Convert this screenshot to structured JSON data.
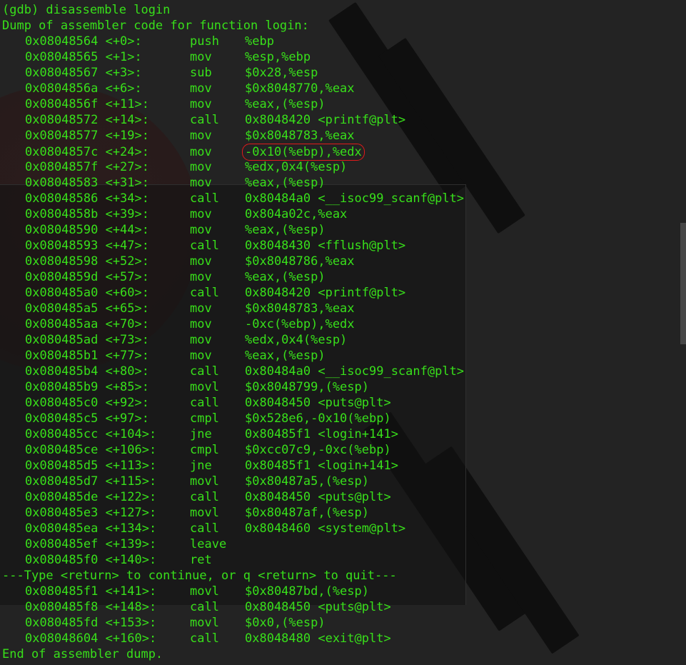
{
  "command_line": "(gdb) disassemble login",
  "dump_header": "Dump of assembler code for function login:",
  "instructions": [
    {
      "addr": "0x08048564 <+0>:",
      "op": "push",
      "args": "%ebp"
    },
    {
      "addr": "0x08048565 <+1>:",
      "op": "mov",
      "args": "%esp,%ebp"
    },
    {
      "addr": "0x08048567 <+3>:",
      "op": "sub",
      "args": "$0x28,%esp"
    },
    {
      "addr": "0x0804856a <+6>:",
      "op": "mov",
      "args": "$0x8048770,%eax"
    },
    {
      "addr": "0x0804856f <+11>:",
      "op": "mov",
      "args": "%eax,(%esp)"
    },
    {
      "addr": "0x08048572 <+14>:",
      "op": "call",
      "args": "0x8048420 <printf@plt>"
    },
    {
      "addr": "0x08048577 <+19>:",
      "op": "mov",
      "args": "$0x8048783,%eax"
    },
    {
      "addr": "0x0804857c <+24>:",
      "op": "mov",
      "args": "-0x10(%ebp),%edx"
    },
    {
      "addr": "0x0804857f <+27>:",
      "op": "mov",
      "args": "%edx,0x4(%esp)"
    },
    {
      "addr": "0x08048583 <+31>:",
      "op": "mov",
      "args": "%eax,(%esp)"
    },
    {
      "addr": "0x08048586 <+34>:",
      "op": "call",
      "args": "0x80484a0 <__isoc99_scanf@plt>"
    },
    {
      "addr": "0x0804858b <+39>:",
      "op": "mov",
      "args": "0x804a02c,%eax"
    },
    {
      "addr": "0x08048590 <+44>:",
      "op": "mov",
      "args": "%eax,(%esp)"
    },
    {
      "addr": "0x08048593 <+47>:",
      "op": "call",
      "args": "0x8048430 <fflush@plt>"
    },
    {
      "addr": "0x08048598 <+52>:",
      "op": "mov",
      "args": "$0x8048786,%eax"
    },
    {
      "addr": "0x0804859d <+57>:",
      "op": "mov",
      "args": "%eax,(%esp)"
    },
    {
      "addr": "0x080485a0 <+60>:",
      "op": "call",
      "args": "0x8048420 <printf@plt>"
    },
    {
      "addr": "0x080485a5 <+65>:",
      "op": "mov",
      "args": "$0x8048783,%eax"
    },
    {
      "addr": "0x080485aa <+70>:",
      "op": "mov",
      "args": "-0xc(%ebp),%edx"
    },
    {
      "addr": "0x080485ad <+73>:",
      "op": "mov",
      "args": "%edx,0x4(%esp)"
    },
    {
      "addr": "0x080485b1 <+77>:",
      "op": "mov",
      "args": "%eax,(%esp)"
    },
    {
      "addr": "0x080485b4 <+80>:",
      "op": "call",
      "args": "0x80484a0 <__isoc99_scanf@plt>"
    },
    {
      "addr": "0x080485b9 <+85>:",
      "op": "movl",
      "args": "$0x8048799,(%esp)"
    },
    {
      "addr": "0x080485c0 <+92>:",
      "op": "call",
      "args": "0x8048450 <puts@plt>"
    },
    {
      "addr": "0x080485c5 <+97>:",
      "op": "cmpl",
      "args": "$0x528e6,-0x10(%ebp)"
    },
    {
      "addr": "0x080485cc <+104>:",
      "op": "jne",
      "args": "0x80485f1 <login+141>"
    },
    {
      "addr": "0x080485ce <+106>:",
      "op": "cmpl",
      "args": "$0xcc07c9,-0xc(%ebp)"
    },
    {
      "addr": "0x080485d5 <+113>:",
      "op": "jne",
      "args": "0x80485f1 <login+141>"
    },
    {
      "addr": "0x080485d7 <+115>:",
      "op": "movl",
      "args": "$0x80487a5,(%esp)"
    },
    {
      "addr": "0x080485de <+122>:",
      "op": "call",
      "args": "0x8048450 <puts@plt>"
    },
    {
      "addr": "0x080485e3 <+127>:",
      "op": "movl",
      "args": "$0x80487af,(%esp)"
    },
    {
      "addr": "0x080485ea <+134>:",
      "op": "call",
      "args": "0x8048460 <system@plt>"
    },
    {
      "addr": "0x080485ef <+139>:",
      "op": "leave",
      "args": ""
    },
    {
      "addr": "0x080485f0 <+140>:",
      "op": "ret",
      "args": ""
    }
  ],
  "continue_prompt": "---Type <return> to continue, or q <return> to quit---",
  "instructions_after": [
    {
      "addr": "0x080485f1 <+141>:",
      "op": "movl",
      "args": "$0x80487bd,(%esp)"
    },
    {
      "addr": "0x080485f8 <+148>:",
      "op": "call",
      "args": "0x8048450 <puts@plt>"
    },
    {
      "addr": "0x080485fd <+153>:",
      "op": "movl",
      "args": "$0x0,(%esp)"
    },
    {
      "addr": "0x08048604 <+160>:",
      "op": "call",
      "args": "0x8048480 <exit@plt>"
    }
  ],
  "dump_footer": "End of assembler dump.",
  "highlighted_instruction_index": 7,
  "colors": {
    "text": "#38e01a",
    "background": "#232323",
    "highlight_circle": "#e01a1a"
  }
}
